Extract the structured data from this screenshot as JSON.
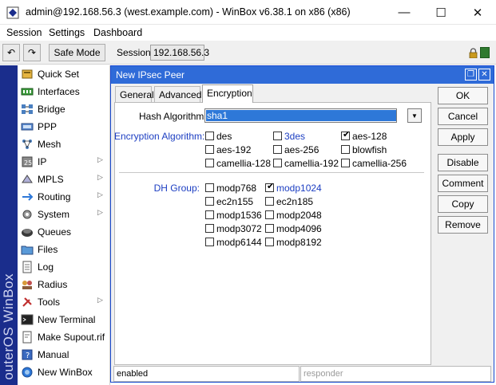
{
  "window": {
    "title": "admin@192.168.56.3 (west.example.com) - WinBox v6.38.1 on x86 (x86)",
    "minimize_glyph": "—",
    "maximize_glyph": "☐",
    "close_glyph": "✕"
  },
  "menubar": {
    "items": [
      "Session",
      "Settings",
      "Dashboard"
    ]
  },
  "toolbar": {
    "undo_glyph": "↶",
    "redo_glyph": "↷",
    "safe_mode_label": "Safe Mode",
    "session_label": "Session:",
    "session_value": "192.168.56.3"
  },
  "brand_strip": {
    "text": "outerOS WinBox"
  },
  "sidebar": {
    "items": [
      {
        "label": "Quick Set",
        "icon": "quick-set-icon",
        "submenu": false
      },
      {
        "label": "Interfaces",
        "icon": "interfaces-icon",
        "submenu": false
      },
      {
        "label": "Bridge",
        "icon": "bridge-icon",
        "submenu": false
      },
      {
        "label": "PPP",
        "icon": "ppp-icon",
        "submenu": false
      },
      {
        "label": "Mesh",
        "icon": "mesh-icon",
        "submenu": false
      },
      {
        "label": "IP",
        "icon": "ip-icon",
        "submenu": true
      },
      {
        "label": "MPLS",
        "icon": "mpls-icon",
        "submenu": true
      },
      {
        "label": "Routing",
        "icon": "routing-icon",
        "submenu": true
      },
      {
        "label": "System",
        "icon": "system-icon",
        "submenu": true
      },
      {
        "label": "Queues",
        "icon": "queues-icon",
        "submenu": false
      },
      {
        "label": "Files",
        "icon": "files-icon",
        "submenu": false
      },
      {
        "label": "Log",
        "icon": "log-icon",
        "submenu": false
      },
      {
        "label": "Radius",
        "icon": "radius-icon",
        "submenu": false
      },
      {
        "label": "Tools",
        "icon": "tools-icon",
        "submenu": true
      },
      {
        "label": "New Terminal",
        "icon": "terminal-icon",
        "submenu": false
      },
      {
        "label": "Make Supout.rif",
        "icon": "supout-icon",
        "submenu": false
      },
      {
        "label": "Manual",
        "icon": "manual-icon",
        "submenu": false
      },
      {
        "label": "New WinBox",
        "icon": "winbox-icon",
        "submenu": false
      }
    ],
    "submenu_arrow": "▷"
  },
  "dialog": {
    "title": "New IPsec Peer",
    "restore_glyph": "❐",
    "close_glyph": "✕",
    "tabs": [
      "General",
      "Advanced",
      "Encryption"
    ],
    "active_tab": "Encryption",
    "hash_label": "Hash Algorithm:",
    "hash_value": "sha1",
    "dropdown_glyph": "▼",
    "encryption_label": "Encryption Algorithm:",
    "encryption_options": [
      {
        "label": "des",
        "checked": false
      },
      {
        "label": "3des",
        "checked": false
      },
      {
        "label": "aes-128",
        "checked": true
      },
      {
        "label": "aes-192",
        "checked": false
      },
      {
        "label": "aes-256",
        "checked": false
      },
      {
        "label": "blowfish",
        "checked": false
      },
      {
        "label": "camellia-128",
        "checked": false
      },
      {
        "label": "camellia-192",
        "checked": false
      },
      {
        "label": "camellia-256",
        "checked": false
      }
    ],
    "dh_label": "DH Group:",
    "dh_options": [
      {
        "label": "modp768",
        "checked": false
      },
      {
        "label": "modp1024",
        "checked": true
      },
      {
        "label": "ec2n155",
        "checked": false
      },
      {
        "label": "ec2n185",
        "checked": false
      },
      {
        "label": "modp1536",
        "checked": false
      },
      {
        "label": "modp2048",
        "checked": false
      },
      {
        "label": "modp3072",
        "checked": false
      },
      {
        "label": "modp4096",
        "checked": false
      },
      {
        "label": "modp6144",
        "checked": false
      },
      {
        "label": "modp8192",
        "checked": false
      }
    ],
    "check_glyph": "✔",
    "buttons": [
      "OK",
      "Cancel",
      "Apply",
      "Disable",
      "Comment",
      "Copy",
      "Remove"
    ],
    "status_left": "enabled",
    "status_right": "responder"
  },
  "colors": {
    "dialog_title": "#2f6bd8",
    "brand_strip": "#1a2d8c",
    "label_blue": "#1c3ec2",
    "selection": "#2e78d8"
  }
}
